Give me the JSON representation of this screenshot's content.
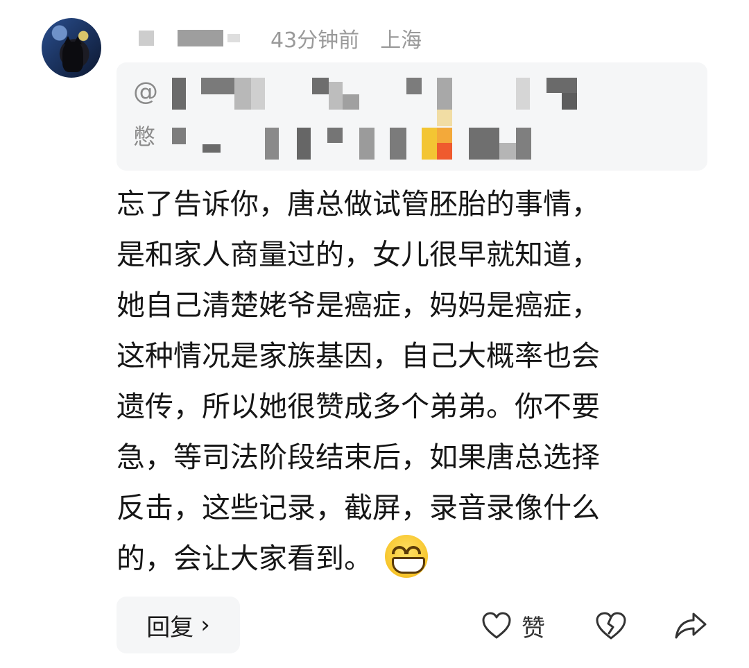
{
  "comment": {
    "time": "43分钟前",
    "location": "上海",
    "quote_at": "@",
    "quote_line2_start": "憋",
    "lines": [
      "忘了告诉你，唐总做试管胚胎的事情，",
      "是和家人商量过的，女儿很早就知道，",
      "她自己清楚姥爷是癌症，妈妈是癌症，",
      "这种情况是家族基因，自己大概率也会",
      "遗传，所以她很赞成多个弟弟。你不要",
      "急，等司法阶段结束后，如果唐总选择",
      "反击，这些记录，截屏，录音录像什么",
      "的，会让大家看到。"
    ],
    "emoji": "grinning-face"
  },
  "actions": {
    "reply_label": "回复",
    "reply_chevron": "›",
    "like_label": "赞"
  }
}
